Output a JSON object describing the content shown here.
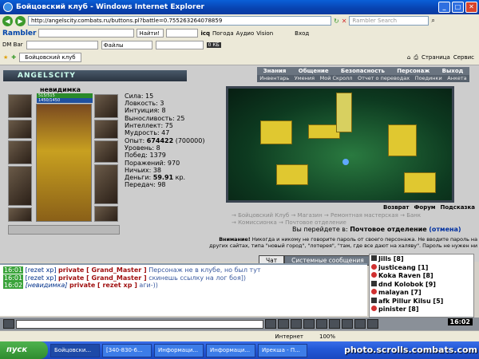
{
  "window": {
    "title": "Бойцовский клуб - Windows Internet Explorer",
    "url": "http://angelscity.combats.ru/buttons.pl?battle=0.755263264078859",
    "search_placeholder": "Rambler Search"
  },
  "toolbar": {
    "rambler": "Rambler",
    "find": "Найти!",
    "icq": "icq",
    "weather": "Погода",
    "audio": "Аудио",
    "vision": "Vision",
    "login": "Вход",
    "dm_bar": "DM Bar",
    "files": "Файлы",
    "counter": "0 КБ"
  },
  "tab": {
    "title": "Бойцовский клуб",
    "page": "Страница",
    "service": "Сервис"
  },
  "game": {
    "logo": "ANGELSCITY",
    "menu1": [
      "Знания",
      "Общение",
      "Безопасность",
      "Персонаж",
      "Выход"
    ],
    "menu2": [
      "Инвентарь",
      "Умения",
      "Мой Скролл",
      "Отчет о переводах",
      "Поединки",
      "Анкета"
    ],
    "char_name": "невидимка",
    "hp": "515/515",
    "mp": "1450/1450",
    "stats": [
      "Сила: 15",
      "Ловкость: 3",
      "Интуиция: 8",
      "Выносливость: 25",
      "Интеллект: 75",
      "Мудрость: 47"
    ],
    "exp_label": "Опыт:",
    "exp_value": "674422",
    "exp_next": "(700000)",
    "stats2": [
      "Уровень: 8",
      "Побед: 1379",
      "Поражений: 970",
      "Ничьих: 38"
    ],
    "money_label": "Деньги:",
    "money_value": "59.91",
    "money_unit": "кр.",
    "transfers": "Передач: 98",
    "scene_links": [
      "Возврат",
      "Форум",
      "Подсказка"
    ],
    "places": [
      "→ Бойцовский Клуб",
      "→ Магазин",
      "→ Ремонтная мастерская",
      "→ Банк",
      "→ Комиссионка",
      "→ Почтовое отделение"
    ],
    "goto_prefix": "Вы перейдете в:",
    "goto_target": "Почтовое отделение",
    "goto_cancel": "(отмена)",
    "warning_bold": "Внимание!",
    "warning_text": "Никогда и никому не говорите пароль от своего персонажа. Не вводите пароль на других сайтах, типа \"новый город\", \"лотерея\", \"там, где все дают на халяву\". Пароль не нужен ни"
  },
  "chat": {
    "tabs": [
      "Чат",
      "Системные сообщения"
    ],
    "lines": [
      {
        "time": "16:01",
        "nick": "[rezet xp]",
        "priv": "private [ Grand_Master ]",
        "msg": "Персонаж не в клубе, но был тут"
      },
      {
        "time": "16:01",
        "nick": "[rezet xp]",
        "priv": "private [ Grand_Master ]",
        "msg": "скинешь ссылку на лог боя])"
      },
      {
        "time": "16:02",
        "nick": "[невидимка]",
        "priv": "private [ rezet xp ]",
        "msg": "аги-))"
      }
    ]
  },
  "users": [
    "Jills [8]",
    "justiceang [1]",
    "Koka Raven [8]",
    "dnd Kolobok [9]",
    "malayan [7]",
    "afk Pillur Kilsu [5]",
    "pinister [8]"
  ],
  "clock": "16:02",
  "status": {
    "zone": "Интернет",
    "zoom": "100%"
  },
  "taskbar": {
    "start": "пуск",
    "tasks": [
      "Бойцовски...",
      "[340-830-6...",
      "Информаци...",
      "Информаци...",
      "Ирекша - П..."
    ]
  },
  "watermark": "photo.scrolls.combats.com"
}
